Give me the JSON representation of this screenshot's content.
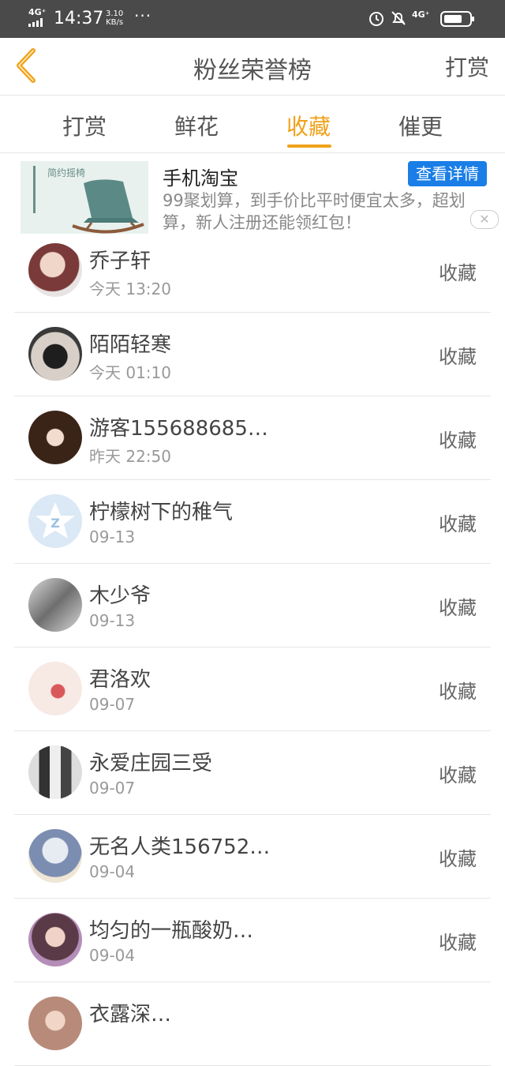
{
  "status_bar": {
    "network": "4G⁺",
    "time": "14:37",
    "speed_value": "3.10",
    "speed_unit": "KB/s",
    "more": "···",
    "right_network": "4G⁺"
  },
  "header": {
    "back_icon": "chevron-left-icon",
    "title": "粉丝荣誉榜",
    "right_button": "打赏"
  },
  "tabs": [
    {
      "label": "打赏",
      "active": false
    },
    {
      "label": "鲜花",
      "active": false
    },
    {
      "label": "收藏",
      "active": true
    },
    {
      "label": "催更",
      "active": false
    }
  ],
  "ad": {
    "title": "手机淘宝",
    "description": "99聚划算，到手价比平时便宜太多，超划算，新人注册还能领红包！",
    "button": "查看详情",
    "close": "✕",
    "thumb_text": "简约摇椅"
  },
  "list": [
    {
      "name": "乔子轩",
      "time": "今天 13:20",
      "action": "收藏",
      "avatar_color": "#7a3a3a"
    },
    {
      "name": "陌陌轻寒",
      "time": "今天 01:10",
      "action": "收藏",
      "avatar_color": "#4f4f4f"
    },
    {
      "name": "游客155688685…",
      "time": "昨天 22:50",
      "action": "收藏",
      "avatar_color": "#5b3a2a"
    },
    {
      "name": "柠檬树下的稚气",
      "time": "09-13",
      "action": "收藏",
      "avatar_color": "#c8dcf0"
    },
    {
      "name": "木少爷",
      "time": "09-13",
      "action": "收藏",
      "avatar_color": "#9a9a9a"
    },
    {
      "name": "君洛欢",
      "time": "09-07",
      "action": "收藏",
      "avatar_color": "#f3d9d9"
    },
    {
      "name": "永爱庄园三受",
      "time": "09-07",
      "action": "收藏",
      "avatar_color": "#555555"
    },
    {
      "name": "无名人类156752…",
      "time": "09-04",
      "action": "收藏",
      "avatar_color": "#a8b4c8"
    },
    {
      "name": "均匀的一瓶酸奶…",
      "time": "09-04",
      "action": "收藏",
      "avatar_color": "#8a6b8e"
    },
    {
      "name": "衣露深…",
      "time": "",
      "action": "",
      "avatar_color": "#b88a7a"
    }
  ],
  "colors": {
    "accent": "#f0a21a",
    "ad_button": "#1a7ee6",
    "status_bar": "#4a4a4a"
  }
}
